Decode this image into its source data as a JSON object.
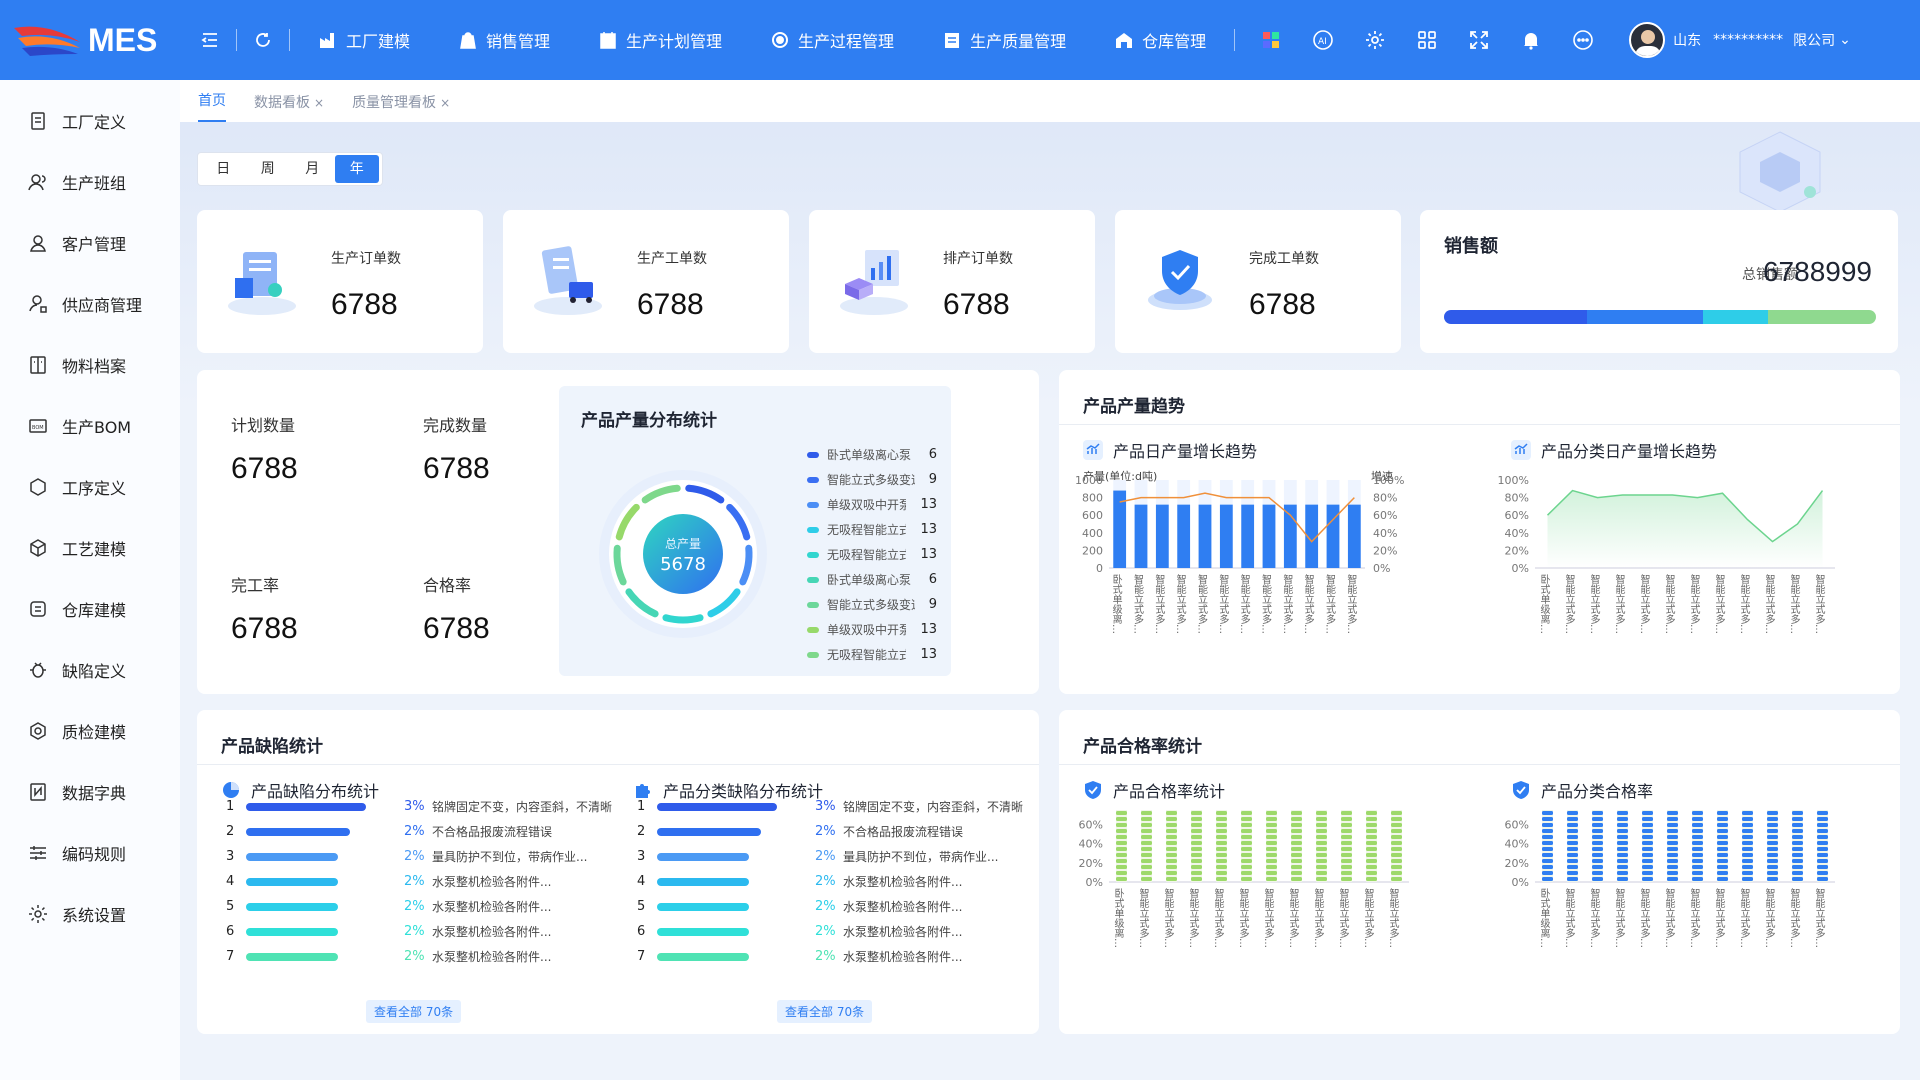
{
  "app": {
    "name": "MES"
  },
  "nav": [
    "工厂建模",
    "销售管理",
    "生产计划管理",
    "生产过程管理",
    "生产质量管理",
    "仓库管理"
  ],
  "user": {
    "region": "山东",
    "name": "**********",
    "company": "限公司"
  },
  "sidebar": [
    "工厂定义",
    "生产班组",
    "客户管理",
    "供应商管理",
    "物料档案",
    "生产BOM",
    "工序定义",
    "工艺建模",
    "仓库建模",
    "缺陷定义",
    "质检建模",
    "数据字典",
    "编码规则",
    "系统设置"
  ],
  "tabs": [
    {
      "label": "首页"
    },
    {
      "label": "数据看板",
      "close": "×"
    },
    {
      "label": "质量管理看板",
      "close": "×"
    }
  ],
  "range": [
    "日",
    "周",
    "月",
    "年"
  ],
  "kpis": [
    {
      "label": "生产订单数",
      "value": "6788"
    },
    {
      "label": "生产工单数",
      "value": "6788"
    },
    {
      "label": "排产订单数",
      "value": "6788"
    },
    {
      "label": "完成工单数",
      "value": "6788"
    }
  ],
  "sales": {
    "title": "销售额",
    "sub": "总销售额",
    "amount": "6788999"
  },
  "stats": [
    {
      "label": "计划数量",
      "value": "6788"
    },
    {
      "label": "完成数量",
      "value": "6788"
    },
    {
      "label": "完工率",
      "value": "6788"
    },
    {
      "label": "合格率",
      "value": "6788"
    }
  ],
  "dist": {
    "title": "产品产量分布统计",
    "center_label": "总产量",
    "total": "5678",
    "items": [
      {
        "name": "卧式单级离心泵",
        "value": "6",
        "color": "#2f5bea"
      },
      {
        "name": "智能立式多级变速泵...",
        "value": "9",
        "color": "#3a6ff2"
      },
      {
        "name": "单级双吸中开泵",
        "value": "13",
        "color": "#4b8ef5"
      },
      {
        "name": "无吸程智能立式多级...",
        "value": "13",
        "color": "#2ecde8"
      },
      {
        "name": "无吸程智能立式多级...",
        "value": "13",
        "color": "#31d6cf"
      },
      {
        "name": "卧式单级离心泵",
        "value": "6",
        "color": "#46d6b5"
      },
      {
        "name": "智能立式多级变速泵...",
        "value": "9",
        "color": "#6cd79a"
      },
      {
        "name": "单级双吸中开泵",
        "value": "13",
        "color": "#97d96a"
      },
      {
        "name": "无吸程智能立式多级...",
        "value": "13",
        "color": "#7ed88b"
      }
    ]
  },
  "trend": {
    "title": "产品产量趋势",
    "left_title": "产品日产量增长趋势",
    "right_title": "产品分类日产量增长趋势",
    "y_label": "产量(单位:d吨)",
    "y2_label": "增速"
  },
  "defect": {
    "title": "产品缺陷统计",
    "left_title": "产品缺陷分布统计",
    "right_title": "产品分类缺陷分布统计",
    "more": "查看全部 70条",
    "rows": [
      {
        "idx": "1",
        "pct": "3%",
        "text": "铭牌固定不变，内容歪斜，不清晰",
        "value": 3,
        "color": "#2f5bea"
      },
      {
        "idx": "2",
        "pct": "2%",
        "text": "不合格品报废流程错误",
        "value": 2.6,
        "color": "#2f6ff0"
      },
      {
        "idx": "3",
        "pct": "2%",
        "text": "量具防护不到位，带病作业...",
        "value": 2.3,
        "color": "#4b9af4"
      },
      {
        "idx": "4",
        "pct": "2%",
        "text": "水泵整机检验各附件...",
        "value": 2.3,
        "color": "#2bb9ef"
      },
      {
        "idx": "5",
        "pct": "2%",
        "text": "水泵整机检验各附件...",
        "value": 2.3,
        "color": "#2ccfe9"
      },
      {
        "idx": "6",
        "pct": "2%",
        "text": "水泵整机检验各附件...",
        "value": 2.3,
        "color": "#2fe0d8"
      },
      {
        "idx": "7",
        "pct": "2%",
        "text": "水泵整机检验各附件...",
        "value": 2.3,
        "color": "#4fe3b4"
      }
    ]
  },
  "quality": {
    "title": "产品合格率统计",
    "left_title": "产品合格率统计",
    "right_title": "产品分类合格率"
  },
  "chart_data": [
    {
      "type": "bar",
      "title": "产品日产量增长趋势",
      "ylabel": "产量(单位:d吨)",
      "y2label": "增速",
      "ylim": [
        0,
        1000
      ],
      "y2lim": [
        0,
        100
      ],
      "categories": [
        "卧式单级离心泵",
        "智能立式多级...",
        "智能立式多级...",
        "智能立式多级...",
        "智能立式多级...",
        "智能立式多级...",
        "智能立式多级...",
        "智能立式多级...",
        "智能立式多级...",
        "智能立式多级...",
        "智能立式多级...",
        "智能立式多级..."
      ],
      "series": [
        {
          "name": "产量",
          "type": "bar",
          "values": [
            880,
            720,
            720,
            720,
            720,
            720,
            720,
            720,
            720,
            720,
            720,
            720
          ]
        },
        {
          "name": "增速",
          "type": "line",
          "values": [
            75,
            80,
            80,
            80,
            85,
            80,
            80,
            80,
            60,
            30,
            55,
            80
          ]
        }
      ]
    },
    {
      "type": "area",
      "title": "产品分类日产量增长趋势",
      "ylim": [
        0,
        100
      ],
      "categories": [
        "卧式单级离心泵",
        "智能立式多级...",
        "智能立式多级...",
        "智能立式多级...",
        "智能立式多级...",
        "智能立式多级...",
        "智能立式多级...",
        "智能立式多级...",
        "智能立式多级...",
        "智能立式多级...",
        "智能立式多级...",
        "智能立式多级..."
      ],
      "values": [
        60,
        88,
        80,
        83,
        83,
        83,
        80,
        85,
        55,
        30,
        50,
        88
      ]
    },
    {
      "type": "bar",
      "title": "产品合格率统计",
      "ylim": [
        0,
        100
      ],
      "categories": [
        "卧式单级离心泵",
        "智能立式多级...",
        "智能立式多级...",
        "智能立式多级...",
        "智能立式多级...",
        "智能立式多级...",
        "智能立式多级...",
        "智能立式多级...",
        "智能立式多级...",
        "智能立式多级...",
        "智能立式多级...",
        "智能立式多级..."
      ],
      "values": [
        93,
        93,
        85,
        93,
        98,
        98,
        93,
        93,
        98,
        85,
        98,
        98
      ]
    },
    {
      "type": "bar",
      "title": "产品分类合格率",
      "ylim": [
        0,
        100
      ],
      "categories": [
        "卧式单级离心泵",
        "智能立式多级...",
        "智能立式多级...",
        "智能立式多级...",
        "智能立式多级...",
        "智能立式多级...",
        "智能立式多级...",
        "智能立式多级...",
        "智能立式多级...",
        "智能立式多级...",
        "智能立式多级...",
        "智能立式多级..."
      ],
      "values": [
        93,
        93,
        85,
        93,
        98,
        98,
        93,
        88,
        98,
        85,
        98,
        98
      ]
    }
  ]
}
